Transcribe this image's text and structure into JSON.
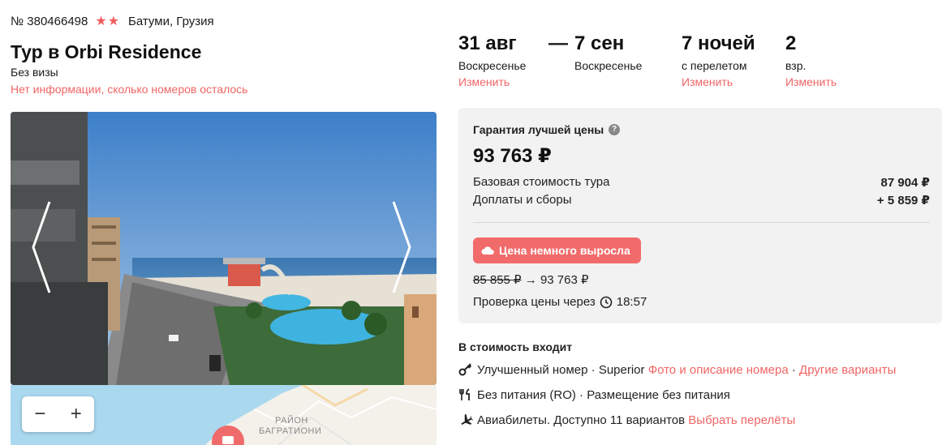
{
  "header": {
    "tour_number": "№ 380466498",
    "stars": "★★",
    "location": "Батуми, Грузия",
    "title": "Тур в Orbi Residence",
    "visa": "Без визы",
    "rooms_info": "Нет информации, сколько номеров осталось"
  },
  "dates": {
    "from": {
      "date": "31 авг",
      "day": "Воскресенье",
      "change": "Изменить"
    },
    "dash": "—",
    "to": {
      "date": "7 сен",
      "day": "Воскресенье"
    },
    "nights": {
      "value": "7 ночей",
      "sub": "с перелетом",
      "change": "Изменить"
    },
    "guests": {
      "value": "2",
      "sub": "взр.",
      "change": "Изменить"
    }
  },
  "map": {
    "zoom_out": "−",
    "zoom_in": "+",
    "district_line1": "РАЙОН",
    "district_line2": "БАГРАТИОНИ"
  },
  "price": {
    "guarantee": "Гарантия лучшей цены",
    "question": "?",
    "total": "93 763 ₽",
    "base_label": "Базовая стоимость тура",
    "base_value": "87 904 ₽",
    "extra_label": "Доплаты и сборы",
    "extra_value": "+ 5 859 ₽",
    "badge": "Цена немного выросла",
    "old_price": "85 855 ₽",
    "arrow": "→",
    "new_price": "93 763 ₽",
    "check_label": "Проверка цены через",
    "check_time": "18:57"
  },
  "included": {
    "title": "В стоимость входит",
    "room": {
      "text": "Улучшенный номер · Superior",
      "link1": "Фото и описание номера",
      "sep": " · ",
      "link2": "Другие варианты"
    },
    "meal": {
      "text": "Без питания (RO) · Размещение без питания"
    },
    "flight": {
      "text": "Авиабилеты. Доступно 11 вариантов",
      "link": "Выбрать перелёты"
    }
  },
  "colors": {
    "accent": "#f06565",
    "badge": "#f26b6b",
    "panel": "#f2f2f2"
  }
}
